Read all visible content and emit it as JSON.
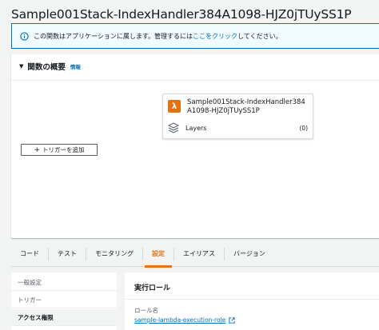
{
  "page": {
    "title": "Sample001Stack-IndexHandler384A1098-HJZ0jTUySS1P"
  },
  "banner": {
    "text_before": "この関数はアプリケーションに属します。管理するには",
    "link_text": "ここをクリック",
    "text_after": "してください。",
    "icon": "info-circle-icon",
    "accent_color": "#0073bb"
  },
  "overview": {
    "title": "関数の概要",
    "info_link": "情報",
    "function_card": {
      "icon": "lambda-icon",
      "name": "Sample001Stack-IndexHandler384A1098-HJZ0jTUySS1P",
      "layers_label": "Layers",
      "layers_count": "(0)"
    },
    "add_trigger_label": "トリガーを追加"
  },
  "tabs": [
    {
      "label": "コード",
      "active": false
    },
    {
      "label": "テスト",
      "active": false
    },
    {
      "label": "モニタリング",
      "active": false
    },
    {
      "label": "設定",
      "active": true
    },
    {
      "label": "エイリアス",
      "active": false
    },
    {
      "label": "バージョン",
      "active": false
    }
  ],
  "sidenav": {
    "items": [
      {
        "label": "一般設定",
        "active": false
      },
      {
        "label": "トリガー",
        "active": false
      },
      {
        "label": "アクセス権限",
        "active": true
      }
    ]
  },
  "detail": {
    "title": "実行ロール",
    "role_label": "ロール名",
    "role_name": "sample-lambda-execution-role",
    "role_link_icon": "external-link-icon"
  },
  "colors": {
    "active_tab": "#ec7211",
    "link": "#0073bb",
    "lambda_icon_bg": "#e07314"
  }
}
